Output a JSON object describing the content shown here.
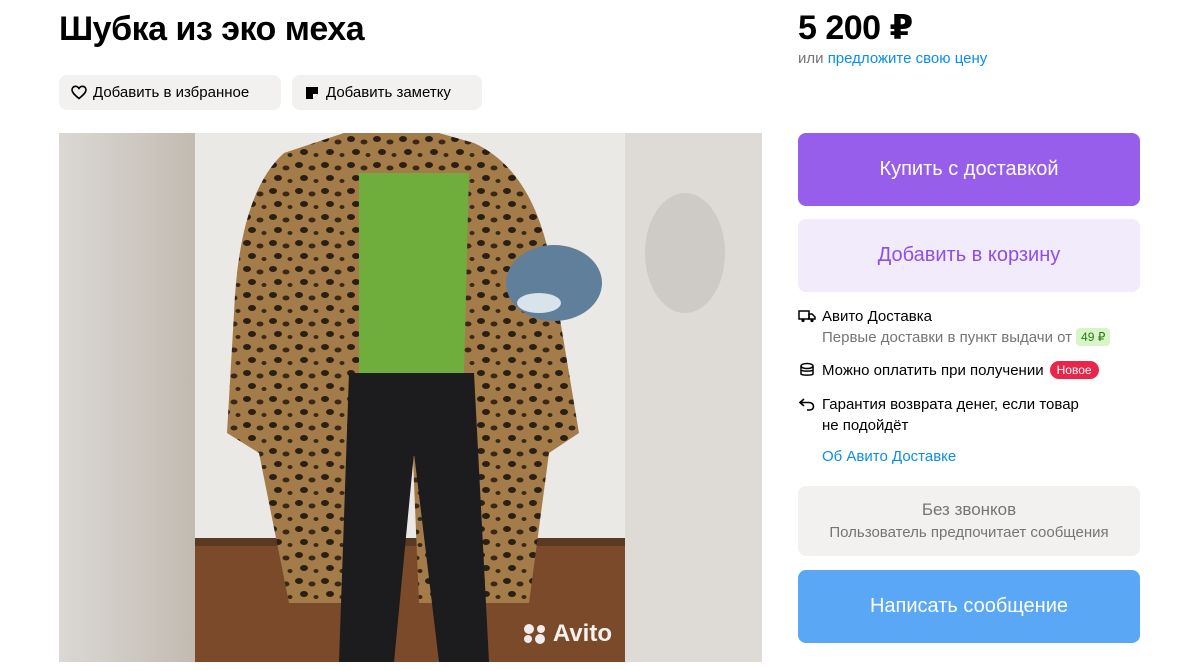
{
  "title": "Шубка из эко меха",
  "actions": {
    "favorite_label": "Добавить в избранное",
    "note_label": "Добавить заметку"
  },
  "price": {
    "value": "5 200 ₽",
    "or_label": "или",
    "offer_link": "предложите свою цену"
  },
  "photo": {
    "watermark": "Avito"
  },
  "buttons": {
    "buy_delivery": "Купить с доставкой",
    "add_to_cart": "Добавить в корзину",
    "write_message": "Написать сообщение"
  },
  "delivery": {
    "title": "Авито Доставка",
    "subtitle": "Первые доставки в пункт выдачи от",
    "price_badge": "49 ₽",
    "pay_on_receipt": "Можно оплатить при получении",
    "new_badge": "Новое",
    "guarantee_line1": "Гарантия возврата денег, если товар",
    "guarantee_line2": "не подойдёт",
    "about_link": "Об Авито Доставке"
  },
  "no_calls": {
    "title": "Без звонков",
    "subtitle": "Пользователь предпочитает сообщения"
  },
  "colors": {
    "primary": "#965eeb",
    "secondary_bg": "#f1ebfc",
    "message_btn": "#5aa8f5",
    "link": "#0a8eed",
    "new_badge": "#e8254a"
  },
  "icons": [
    "heart-icon",
    "note-icon",
    "truck-icon",
    "coins-icon",
    "return-arrow-icon",
    "avito-logo-icon"
  ]
}
